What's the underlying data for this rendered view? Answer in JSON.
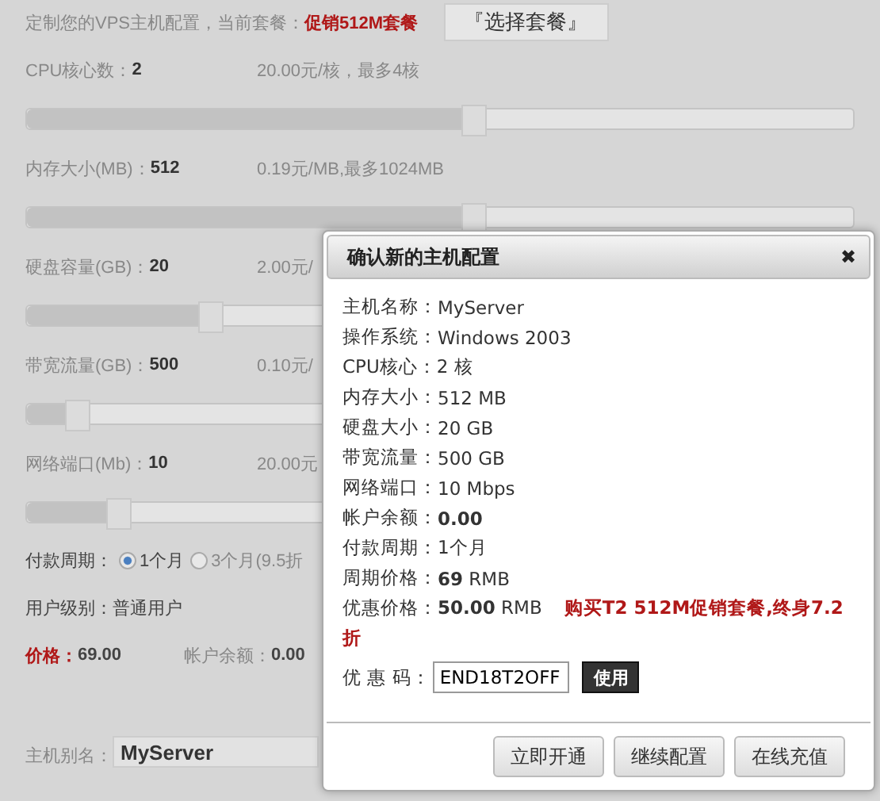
{
  "header": {
    "text": "定制您的VPS主机配置，当前套餐：",
    "plan": "促销512M套餐",
    "button": "『选择套餐』"
  },
  "sliders": [
    {
      "label": "CPU核心数：",
      "value": "2",
      "price": "20.00元/核，最多4核",
      "level": 0.54
    },
    {
      "label": "内存大小(MB)：",
      "value": "512",
      "price": "0.19元/MB,最多1024MB",
      "level": 0.54
    },
    {
      "label": "硬盘容量(GB)：",
      "value": "20",
      "price": "2.00元/",
      "level": 0.22
    },
    {
      "label": "带宽流量(GB)：",
      "value": "500",
      "price": "0.10元/",
      "level": 0.06
    },
    {
      "label": "网络端口(Mb)：",
      "value": "10",
      "price": "20.00元",
      "level": 0.11
    }
  ],
  "payment": {
    "label": "付款周期：",
    "options": [
      {
        "label": "1个月",
        "selected": true
      },
      {
        "label": "3个月(9.5折",
        "selected": false
      }
    ]
  },
  "user_level": {
    "label": "用户级别：",
    "value": "普通用户"
  },
  "price": {
    "label": "价格：",
    "value": "69.00"
  },
  "balance": {
    "label": "帐户余额：",
    "value": "0.00"
  },
  "alias": {
    "label": "主机别名：",
    "value": "MyServer"
  },
  "dialog": {
    "title": "确认新的主机配置",
    "close": "✖",
    "fields": [
      {
        "label": "主机名称：",
        "value": "MyServer"
      },
      {
        "label": "操作系统：",
        "value": "Windows 2003"
      },
      {
        "label": "CPU核心：",
        "value": "2 核"
      },
      {
        "label": "内存大小：",
        "value": "512 MB"
      },
      {
        "label": "硬盘大小：",
        "value": "20 GB"
      },
      {
        "label": "带宽流量：",
        "value": "500 GB"
      },
      {
        "label": "网络端口：",
        "value": "10 Mbps"
      },
      {
        "label": "帐户余额：",
        "value": "**0.00**"
      },
      {
        "label": "付款周期：",
        "value": "1个月"
      },
      {
        "label": "周期价格：",
        "value": "**69** RMB"
      }
    ],
    "discount": {
      "label": "优惠价格：",
      "value": "**50.00** RMB",
      "promo": "购买T2 512M促销套餐,终身7.2折"
    },
    "coupon": {
      "label": "优 惠 码：",
      "value": "END18T2OFF",
      "button": "使用"
    },
    "buttons": [
      "立即开通",
      "继续配置",
      "在线充值"
    ]
  }
}
